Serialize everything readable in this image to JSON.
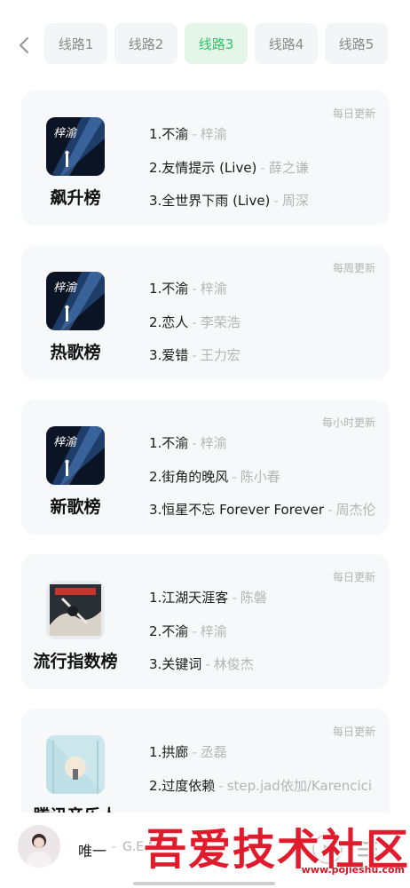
{
  "header": {
    "back_icon": "chevron-left-icon",
    "tabs": [
      {
        "label": "线路1",
        "active": false
      },
      {
        "label": "线路2",
        "active": false
      },
      {
        "label": "线路3",
        "active": true
      },
      {
        "label": "线路4",
        "active": false
      },
      {
        "label": "线路5",
        "active": false
      }
    ],
    "active_color": "#33c26a"
  },
  "charts": [
    {
      "name": "飙升榜",
      "frequency": "每日更新",
      "songs": [
        {
          "title": "1.不渝",
          "artist": "梓渝"
        },
        {
          "title": "2.友情提示 (Live)",
          "artist": "薛之谦"
        },
        {
          "title": "3.全世界下雨 (Live)",
          "artist": "周深"
        }
      ]
    },
    {
      "name": "热歌榜",
      "frequency": "每周更新",
      "songs": [
        {
          "title": "1.不渝",
          "artist": "梓渝"
        },
        {
          "title": "2.恋人",
          "artist": "李荣浩"
        },
        {
          "title": "3.爱错",
          "artist": "王力宏"
        }
      ]
    },
    {
      "name": "新歌榜",
      "frequency": "每小时更新",
      "songs": [
        {
          "title": "1.不渝",
          "artist": "梓渝"
        },
        {
          "title": "2.街角的晚风",
          "artist": "陈小春"
        },
        {
          "title": "3.恒星不忘 Forever Forever",
          "artist": "周杰伦"
        }
      ]
    },
    {
      "name": "流行指数榜",
      "frequency": "每日更新",
      "songs": [
        {
          "title": "1.江湖天涯客",
          "artist": "陈磐"
        },
        {
          "title": "2.不渝",
          "artist": "梓渝"
        },
        {
          "title": "3.关键词",
          "artist": "林俊杰"
        }
      ]
    },
    {
      "name": "腾讯音乐人",
      "frequency": "每日更新",
      "songs": [
        {
          "title": "1.拱廊",
          "artist": "丞磊"
        },
        {
          "title": "2.过度依赖",
          "artist": "step.jad依加/Karencici"
        }
      ]
    }
  ],
  "song_separator": "-",
  "player": {
    "title": "唯一",
    "artist": "G.E.M.",
    "play_icon": "play-icon",
    "playlist_icon": "playlist-icon"
  },
  "watermark": {
    "text": "吾爱技术社区",
    "url": "www.pojieshu.com",
    "color": "#e01b2c"
  }
}
